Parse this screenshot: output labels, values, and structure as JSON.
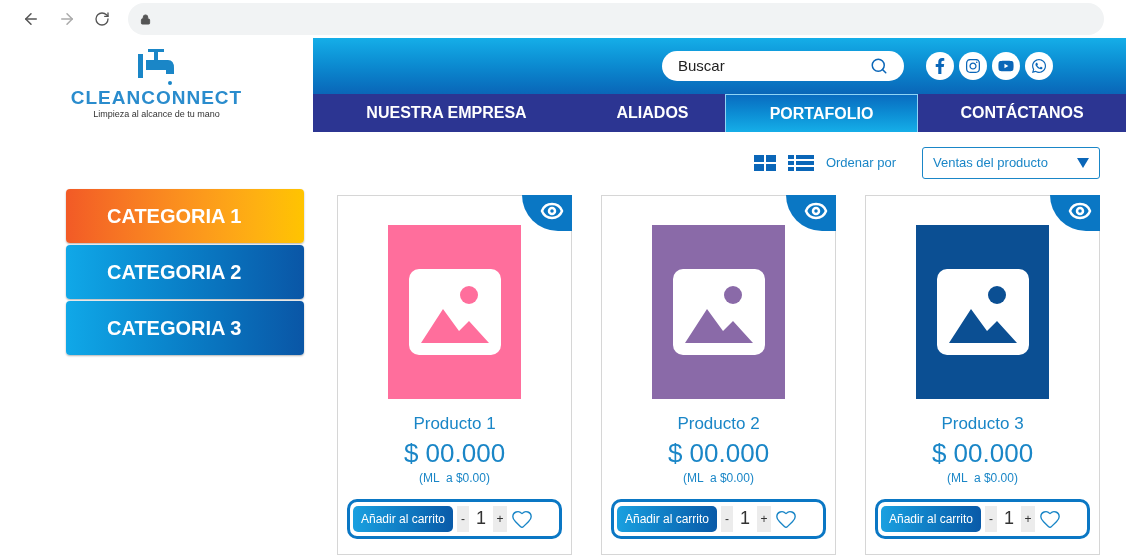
{
  "logo": {
    "name": "CLEANCONNECT",
    "tagline": "Limpieza al alcance de tu mano"
  },
  "search": {
    "placeholder": "Buscar"
  },
  "social": [
    {
      "kind": "facebook"
    },
    {
      "kind": "instagram"
    },
    {
      "kind": "youtube"
    },
    {
      "kind": "whatsapp"
    }
  ],
  "nav": [
    {
      "label": "NUESTRA EMPRESA",
      "selected": false
    },
    {
      "label": "ALIADOS",
      "selected": false
    },
    {
      "label": "PORTAFOLIO",
      "selected": true
    },
    {
      "label": "CONTÁCTANOS",
      "selected": false
    }
  ],
  "toolbar": {
    "sort_label": "Ordenar por",
    "sort_value": "Ventas del producto"
  },
  "categories": [
    {
      "label": "CATEGORIA 1",
      "selected": true
    },
    {
      "label": "CATEGORIA 2",
      "selected": false
    },
    {
      "label": "CATEGORIA 3",
      "selected": false
    }
  ],
  "products": [
    {
      "name": "Producto 1",
      "price": "$ 00.000",
      "unit_price": "(ML  a $0.00)",
      "color": "#ff6e9c",
      "add_label": "Añadir al carrito",
      "minus": "-",
      "quantity": "1",
      "plus": "+"
    },
    {
      "name": "Producto 2",
      "price": "$ 00.000",
      "unit_price": "(ML  a $0.00)",
      "color": "#8a6aa8",
      "add_label": "Añadir al carrito",
      "minus": "-",
      "quantity": "1",
      "plus": "+"
    },
    {
      "name": "Producto 3",
      "price": "$ 00.000",
      "unit_price": "(ML  a $0.00)",
      "color": "#0b4f93",
      "add_label": "Añadir al carrito",
      "minus": "-",
      "quantity": "1",
      "plus": "+"
    }
  ]
}
